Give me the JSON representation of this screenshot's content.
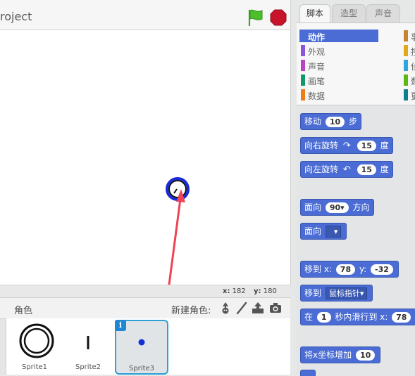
{
  "stage": {
    "project_title": "roject",
    "coords": {
      "x_label": "x:",
      "x_value": "182",
      "y_label": "y:",
      "y_value": "180"
    }
  },
  "sprites": {
    "header_label": "角色",
    "new_sprite_label": "新建角色:",
    "items": [
      {
        "name": "Sprite1"
      },
      {
        "name": "Sprite2"
      },
      {
        "name": "Sprite3",
        "info_badge": "i"
      }
    ]
  },
  "tabs": [
    {
      "label": "脚本",
      "active": true
    },
    {
      "label": "造型",
      "active": false
    },
    {
      "label": "声音",
      "active": false
    }
  ],
  "categories": [
    {
      "label": "动作",
      "color": "#4a6cd4",
      "active": true
    },
    {
      "label": "外观",
      "color": "#8a55d7"
    },
    {
      "label": "声音",
      "color": "#bb42c3"
    },
    {
      "label": "画笔",
      "color": "#0e9a6c"
    },
    {
      "label": "数据",
      "color": "#ee7d16"
    }
  ],
  "categories_right": [
    {
      "color": "#c88330",
      "text": "事"
    },
    {
      "color": "#e1a91a",
      "text": "控"
    },
    {
      "color": "#2ca5e2",
      "text": "侦"
    },
    {
      "color": "#5cb712",
      "text": "数"
    },
    {
      "color": "#0e7f8c",
      "text": "更"
    }
  ],
  "blocks": {
    "move": {
      "a": "移动",
      "v": "10",
      "b": "步"
    },
    "turn_right": {
      "a": "向右旋转",
      "v": "15",
      "b": "度"
    },
    "turn_left": {
      "a": "向左旋转",
      "v": "15",
      "b": "度"
    },
    "point_dir": {
      "a": "面向",
      "v": "90▾",
      "b": "方向"
    },
    "point_towards": {
      "a": "面向"
    },
    "goto_xy": {
      "a": "移到 x:",
      "x": "78",
      "b": "y:",
      "y": "-32"
    },
    "goto": {
      "a": "移到",
      "v": "鼠标指针▾"
    },
    "glide": {
      "a": "在",
      "v": "1",
      "b": "秒内滑行到 x:",
      "x": "78"
    },
    "change_x": {
      "a": "将x坐标增加",
      "v": "10"
    }
  },
  "colors": {
    "motion": "#4a6cd4",
    "accent": "#2f9fd8",
    "arrow": "#ee4455"
  }
}
